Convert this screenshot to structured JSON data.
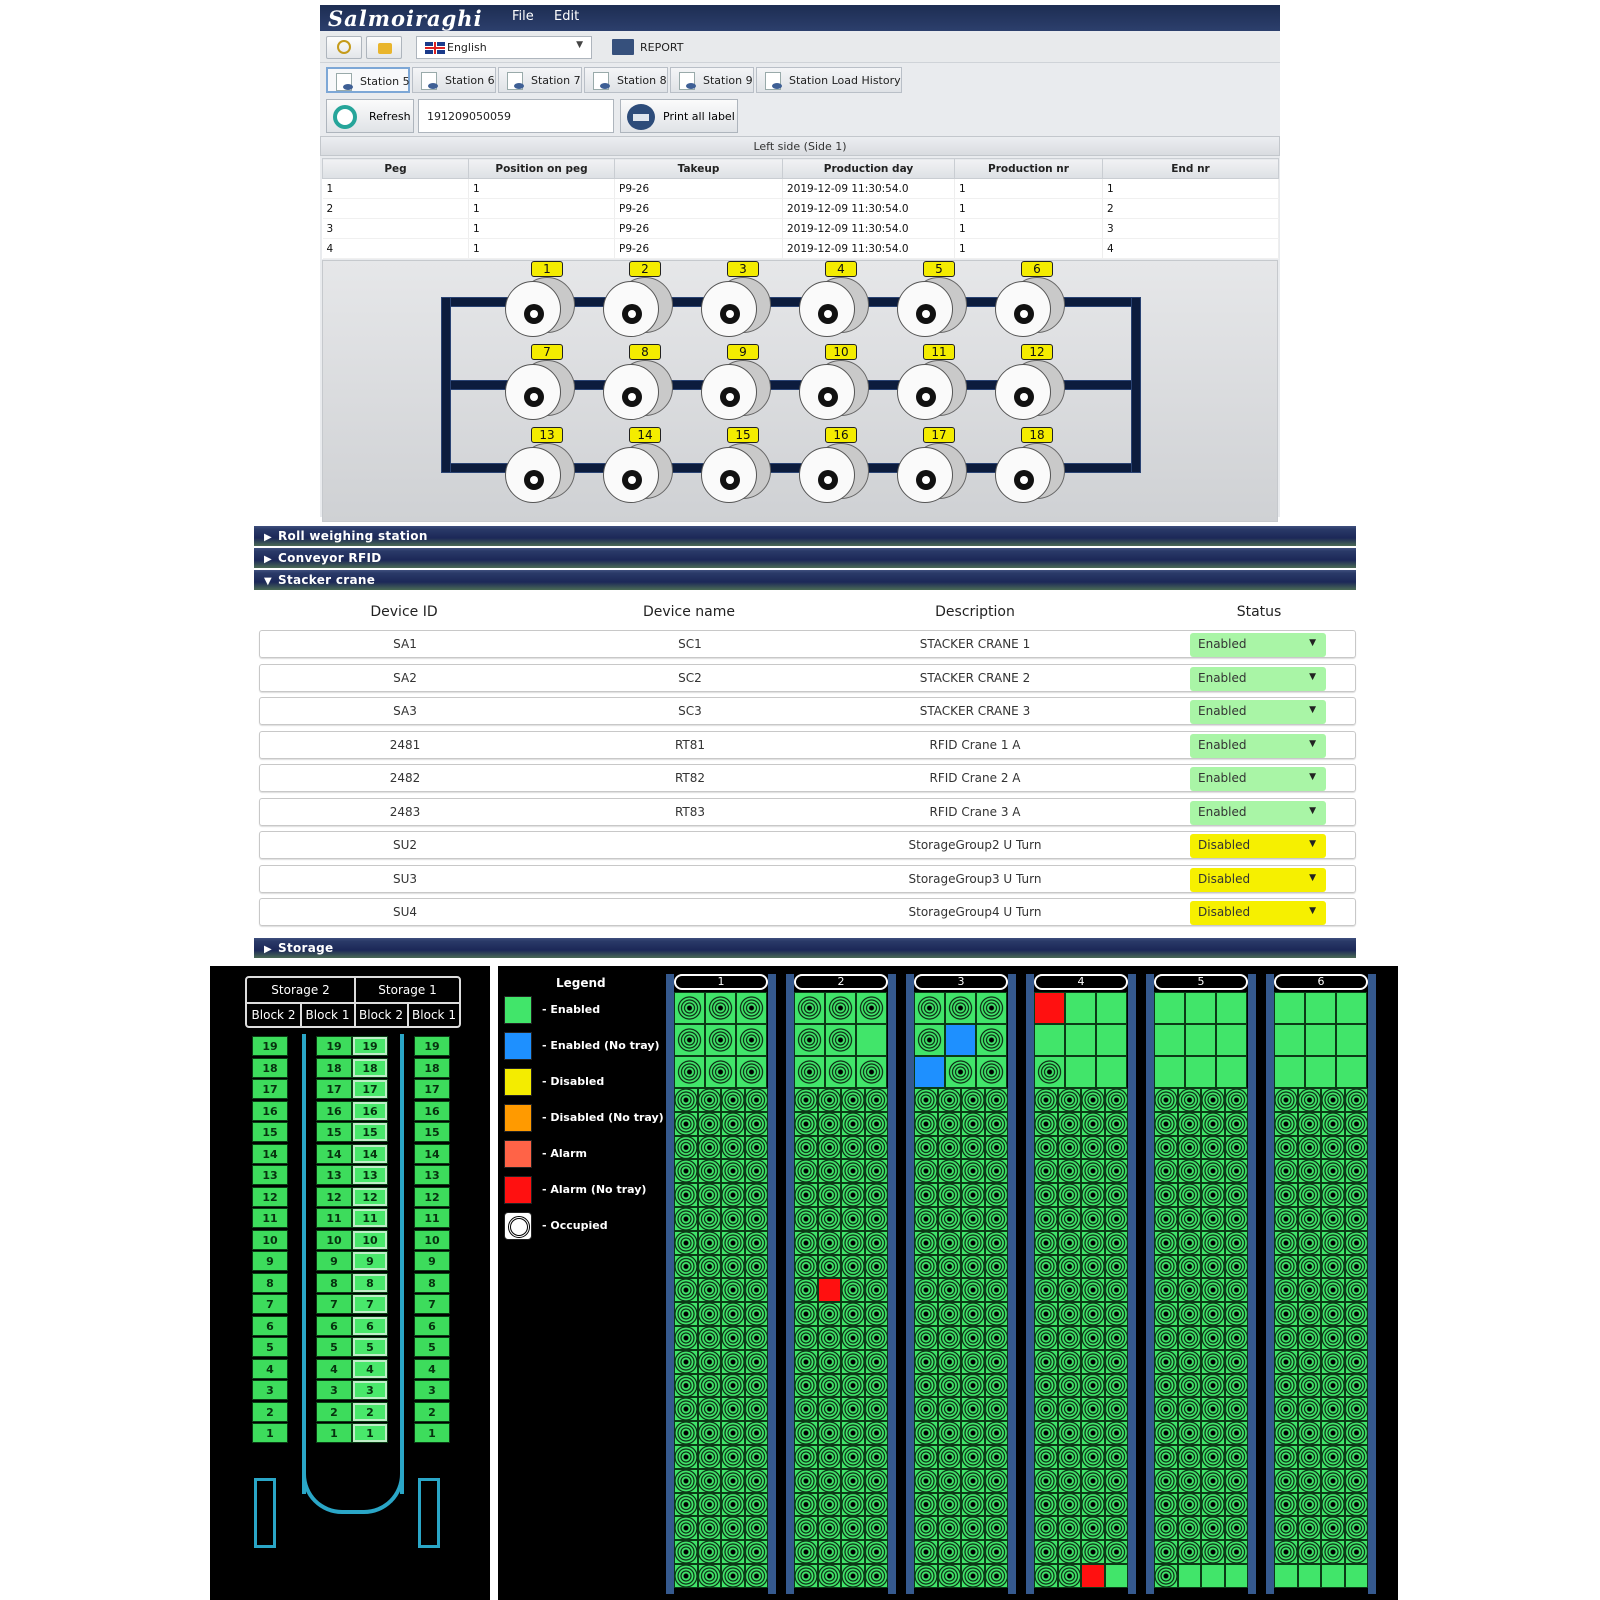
{
  "app": {
    "logo": "Salmoiraghi",
    "menu": [
      "File",
      "Edit"
    ]
  },
  "toolbar": {
    "language": "English",
    "report": "REPORT"
  },
  "tabs": [
    "Station 5",
    "Station 6",
    "Station 7",
    "Station 8",
    "Station 9",
    "Station Load History"
  ],
  "actions": {
    "refresh": "Refresh",
    "barcode": "191209050059",
    "print_all": "Print all label"
  },
  "peg_grid": {
    "title": "Left side (Side 1)",
    "columns": [
      "Peg",
      "Position on peg",
      "Takeup",
      "Production day",
      "Production nr",
      "End nr"
    ],
    "rows": [
      [
        "1",
        "1",
        "P9-26",
        "2019-12-09 11:30:54.0",
        "1",
        "1"
      ],
      [
        "2",
        "1",
        "P9-26",
        "2019-12-09 11:30:54.0",
        "1",
        "2"
      ],
      [
        "3",
        "1",
        "P9-26",
        "2019-12-09 11:30:54.0",
        "1",
        "3"
      ],
      [
        "4",
        "1",
        "P9-26",
        "2019-12-09 11:30:54.0",
        "1",
        "4"
      ]
    ],
    "roll_numbers": [
      "1",
      "2",
      "3",
      "4",
      "5",
      "6",
      "7",
      "8",
      "9",
      "10",
      "11",
      "12",
      "13",
      "14",
      "15",
      "16",
      "17",
      "18"
    ],
    "label_color": "#f4ec00"
  },
  "accordion": {
    "sections": [
      "Roll weighing station",
      "Conveyor RFID",
      "Stacker crane",
      "Storage"
    ],
    "device_columns": [
      "Device ID",
      "Device name",
      "Description",
      "Status"
    ],
    "devices": [
      {
        "id": "SA1",
        "name": "SC1",
        "description": "STACKER CRANE 1",
        "status": "Enabled"
      },
      {
        "id": "SA2",
        "name": "SC2",
        "description": "STACKER CRANE 2",
        "status": "Enabled"
      },
      {
        "id": "SA3",
        "name": "SC3",
        "description": "STACKER CRANE 3",
        "status": "Enabled"
      },
      {
        "id": "2481",
        "name": "RT81",
        "description": "RFID Crane 1 A",
        "status": "Enabled"
      },
      {
        "id": "2482",
        "name": "RT82",
        "description": "RFID Crane 2 A",
        "status": "Enabled"
      },
      {
        "id": "2483",
        "name": "RT83",
        "description": "RFID Crane 3 A",
        "status": "Enabled"
      },
      {
        "id": "SU2",
        "name": "",
        "description": "StorageGroup2 U Turn",
        "status": "Disabled"
      },
      {
        "id": "SU3",
        "name": "",
        "description": "StorageGroup3 U Turn",
        "status": "Disabled"
      },
      {
        "id": "SU4",
        "name": "",
        "description": "StorageGroup4 U Turn",
        "status": "Disabled"
      }
    ],
    "status_colors": {
      "Enabled": "#a9f5a6",
      "Disabled": "#f6f000"
    }
  },
  "storage_map": {
    "storages": [
      "Storage 2",
      "Storage 1"
    ],
    "blocks": [
      "Block 2",
      "Block 1",
      "Block 2",
      "Block 1"
    ],
    "slot_numbers": [
      "19",
      "18",
      "17",
      "16",
      "15",
      "14",
      "13",
      "12",
      "11",
      "10",
      "9",
      "8",
      "7",
      "6",
      "5",
      "4",
      "3",
      "2",
      "1"
    ]
  },
  "legend": {
    "title": "Legend",
    "items": [
      {
        "label": "- Enabled",
        "color": "#41e56a"
      },
      {
        "label": "- Enabled (No tray)",
        "color": "#1e90ff"
      },
      {
        "label": "- Disabled",
        "color": "#f4ec00"
      },
      {
        "label": "- Disabled (No tray)",
        "color": "#ff9a00"
      },
      {
        "label": "- Alarm",
        "color": "#ff6347"
      },
      {
        "label": "- Alarm (No tray)",
        "color": "#ff1010"
      },
      {
        "label": "- Occupied",
        "icon": "spiral-icon"
      }
    ]
  },
  "storage_columns": [
    "1",
    "2",
    "3",
    "4",
    "5",
    "6"
  ]
}
